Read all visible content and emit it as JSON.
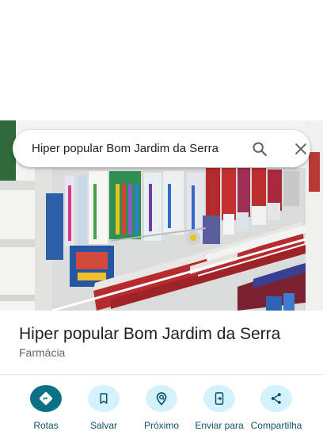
{
  "search": {
    "query": "Hiper popular Bom Jardim da Serra",
    "search_icon": "search-icon",
    "close_icon": "close-icon"
  },
  "place": {
    "name": "Hiper popular Bom Jardim da Serra",
    "category": "Farmácia"
  },
  "actions": [
    {
      "label": "Rotas",
      "icon": "directions-icon"
    },
    {
      "label": "Salvar",
      "icon": "bookmark-icon"
    },
    {
      "label": "Próximo",
      "icon": "nearby-icon"
    },
    {
      "label": "Enviar para",
      "icon": "send-to-phone-icon"
    },
    {
      "label": "Compartilha",
      "icon": "share-icon"
    }
  ],
  "colors": {
    "accent": "#0b7285",
    "action_bg": "#d3f2fb",
    "action_label": "#0b5566"
  }
}
